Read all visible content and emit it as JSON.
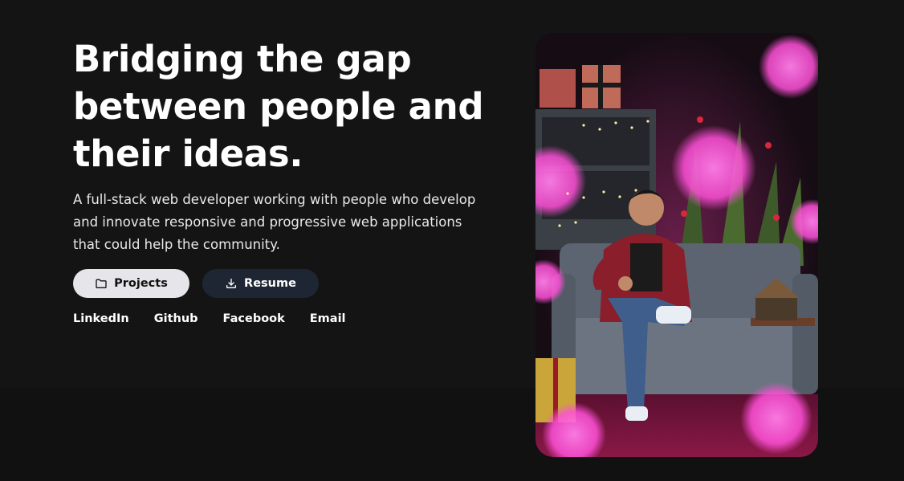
{
  "hero": {
    "headline_line1": "Bridging the gap",
    "headline_line2": "between people and",
    "headline_line3": "their ideas.",
    "description": "A full-stack web developer working with people who develop and innovate responsive and progressive web applications that could help the community."
  },
  "actions": {
    "projects_label": "Projects",
    "projects_icon": "folder-icon",
    "resume_label": "Resume",
    "resume_icon": "download-icon"
  },
  "social_links": {
    "linkedin": "LinkedIn",
    "github": "Github",
    "facebook": "Facebook",
    "email": "Email"
  },
  "photo": {
    "subject": "portrait-photo",
    "accent_color": "#ff4fd8"
  },
  "colors": {
    "background": "#141414",
    "primary_button": "#e6e6ea",
    "secondary_button": "#1f2633",
    "text": "#ffffff"
  }
}
